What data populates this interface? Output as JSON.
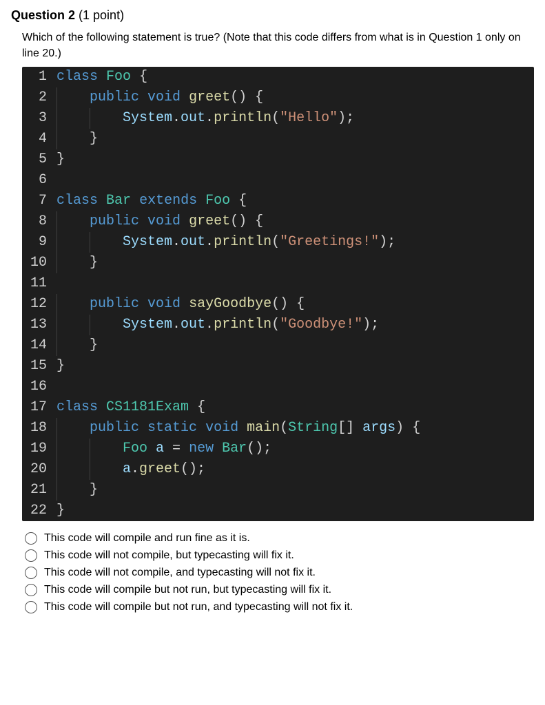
{
  "question": {
    "label_prefix": "Question ",
    "number": "2",
    "points": " (1 point)",
    "prompt": "Which of the following statement is true? (Note that this code differs from what is in Question 1 only on line 20.)"
  },
  "code_lines": [
    {
      "n": "1",
      "indent": 0,
      "tokens": [
        [
          "kw",
          "class"
        ],
        [
          "plain",
          " "
        ],
        [
          "type",
          "Foo"
        ],
        [
          "plain",
          " "
        ],
        [
          "brace",
          "{"
        ]
      ]
    },
    {
      "n": "2",
      "indent": 1,
      "tokens": [
        [
          "kw",
          "public"
        ],
        [
          "plain",
          " "
        ],
        [
          "kw",
          "void"
        ],
        [
          "plain",
          " "
        ],
        [
          "fn",
          "greet"
        ],
        [
          "plain",
          "() "
        ],
        [
          "brace",
          "{"
        ]
      ]
    },
    {
      "n": "3",
      "indent": 2,
      "tokens": [
        [
          "var",
          "System"
        ],
        [
          "dot",
          "."
        ],
        [
          "var",
          "out"
        ],
        [
          "dot",
          "."
        ],
        [
          "fn",
          "println"
        ],
        [
          "plain",
          "("
        ],
        [
          "str",
          "\"Hello\""
        ],
        [
          "plain",
          ");"
        ]
      ]
    },
    {
      "n": "4",
      "indent": 1,
      "tokens": [
        [
          "brace",
          "}"
        ]
      ]
    },
    {
      "n": "5",
      "indent": 0,
      "tokens": [
        [
          "brace",
          "}"
        ]
      ]
    },
    {
      "n": "6",
      "indent": 0,
      "tokens": []
    },
    {
      "n": "7",
      "indent": 0,
      "tokens": [
        [
          "kw",
          "class"
        ],
        [
          "plain",
          " "
        ],
        [
          "type",
          "Bar"
        ],
        [
          "plain",
          " "
        ],
        [
          "kw",
          "extends"
        ],
        [
          "plain",
          " "
        ],
        [
          "type",
          "Foo"
        ],
        [
          "plain",
          " "
        ],
        [
          "brace",
          "{"
        ]
      ]
    },
    {
      "n": "8",
      "indent": 1,
      "tokens": [
        [
          "kw",
          "public"
        ],
        [
          "plain",
          " "
        ],
        [
          "kw",
          "void"
        ],
        [
          "plain",
          " "
        ],
        [
          "fn",
          "greet"
        ],
        [
          "plain",
          "() "
        ],
        [
          "brace",
          "{"
        ]
      ]
    },
    {
      "n": "9",
      "indent": 2,
      "tokens": [
        [
          "var",
          "System"
        ],
        [
          "dot",
          "."
        ],
        [
          "var",
          "out"
        ],
        [
          "dot",
          "."
        ],
        [
          "fn",
          "println"
        ],
        [
          "plain",
          "("
        ],
        [
          "str",
          "\"Greetings!\""
        ],
        [
          "plain",
          ");"
        ]
      ]
    },
    {
      "n": "10",
      "indent": 1,
      "tokens": [
        [
          "brace",
          "}"
        ]
      ]
    },
    {
      "n": "11",
      "indent": 0,
      "tokens": []
    },
    {
      "n": "12",
      "indent": 1,
      "tokens": [
        [
          "kw",
          "public"
        ],
        [
          "plain",
          " "
        ],
        [
          "kw",
          "void"
        ],
        [
          "plain",
          " "
        ],
        [
          "fn",
          "sayGoodbye"
        ],
        [
          "plain",
          "() "
        ],
        [
          "brace",
          "{"
        ]
      ]
    },
    {
      "n": "13",
      "indent": 2,
      "tokens": [
        [
          "var",
          "System"
        ],
        [
          "dot",
          "."
        ],
        [
          "var",
          "out"
        ],
        [
          "dot",
          "."
        ],
        [
          "fn",
          "println"
        ],
        [
          "plain",
          "("
        ],
        [
          "str",
          "\"Goodbye!\""
        ],
        [
          "plain",
          ");"
        ]
      ]
    },
    {
      "n": "14",
      "indent": 1,
      "tokens": [
        [
          "brace",
          "}"
        ]
      ]
    },
    {
      "n": "15",
      "indent": 0,
      "tokens": [
        [
          "brace",
          "}"
        ]
      ]
    },
    {
      "n": "16",
      "indent": 0,
      "tokens": []
    },
    {
      "n": "17",
      "indent": 0,
      "tokens": [
        [
          "kw",
          "class"
        ],
        [
          "plain",
          " "
        ],
        [
          "type",
          "CS1181Exam"
        ],
        [
          "plain",
          " "
        ],
        [
          "brace",
          "{"
        ]
      ]
    },
    {
      "n": "18",
      "indent": 1,
      "tokens": [
        [
          "kw",
          "public"
        ],
        [
          "plain",
          " "
        ],
        [
          "kw",
          "static"
        ],
        [
          "plain",
          " "
        ],
        [
          "kw",
          "void"
        ],
        [
          "plain",
          " "
        ],
        [
          "fn",
          "main"
        ],
        [
          "plain",
          "("
        ],
        [
          "type",
          "String"
        ],
        [
          "plain",
          "[] "
        ],
        [
          "var",
          "args"
        ],
        [
          "plain",
          ") "
        ],
        [
          "brace",
          "{"
        ]
      ]
    },
    {
      "n": "19",
      "indent": 2,
      "tokens": [
        [
          "type",
          "Foo"
        ],
        [
          "plain",
          " "
        ],
        [
          "var",
          "a"
        ],
        [
          "plain",
          " = "
        ],
        [
          "kw",
          "new"
        ],
        [
          "plain",
          " "
        ],
        [
          "type",
          "Bar"
        ],
        [
          "plain",
          "();"
        ]
      ]
    },
    {
      "n": "20",
      "indent": 2,
      "tokens": [
        [
          "var",
          "a"
        ],
        [
          "dot",
          "."
        ],
        [
          "fn",
          "greet"
        ],
        [
          "plain",
          "();"
        ]
      ]
    },
    {
      "n": "21",
      "indent": 1,
      "tokens": [
        [
          "brace",
          "}"
        ]
      ]
    },
    {
      "n": "22",
      "indent": 0,
      "tokens": [
        [
          "brace",
          "}"
        ]
      ]
    }
  ],
  "answers": [
    "This code will compile and run fine as it is.",
    "This code will not compile, but typecasting will fix it.",
    "This code will not compile, and typecasting will not fix it.",
    "This code will compile but not run, but typecasting will fix it.",
    "This code will compile but not run, and typecasting will not fix it."
  ]
}
